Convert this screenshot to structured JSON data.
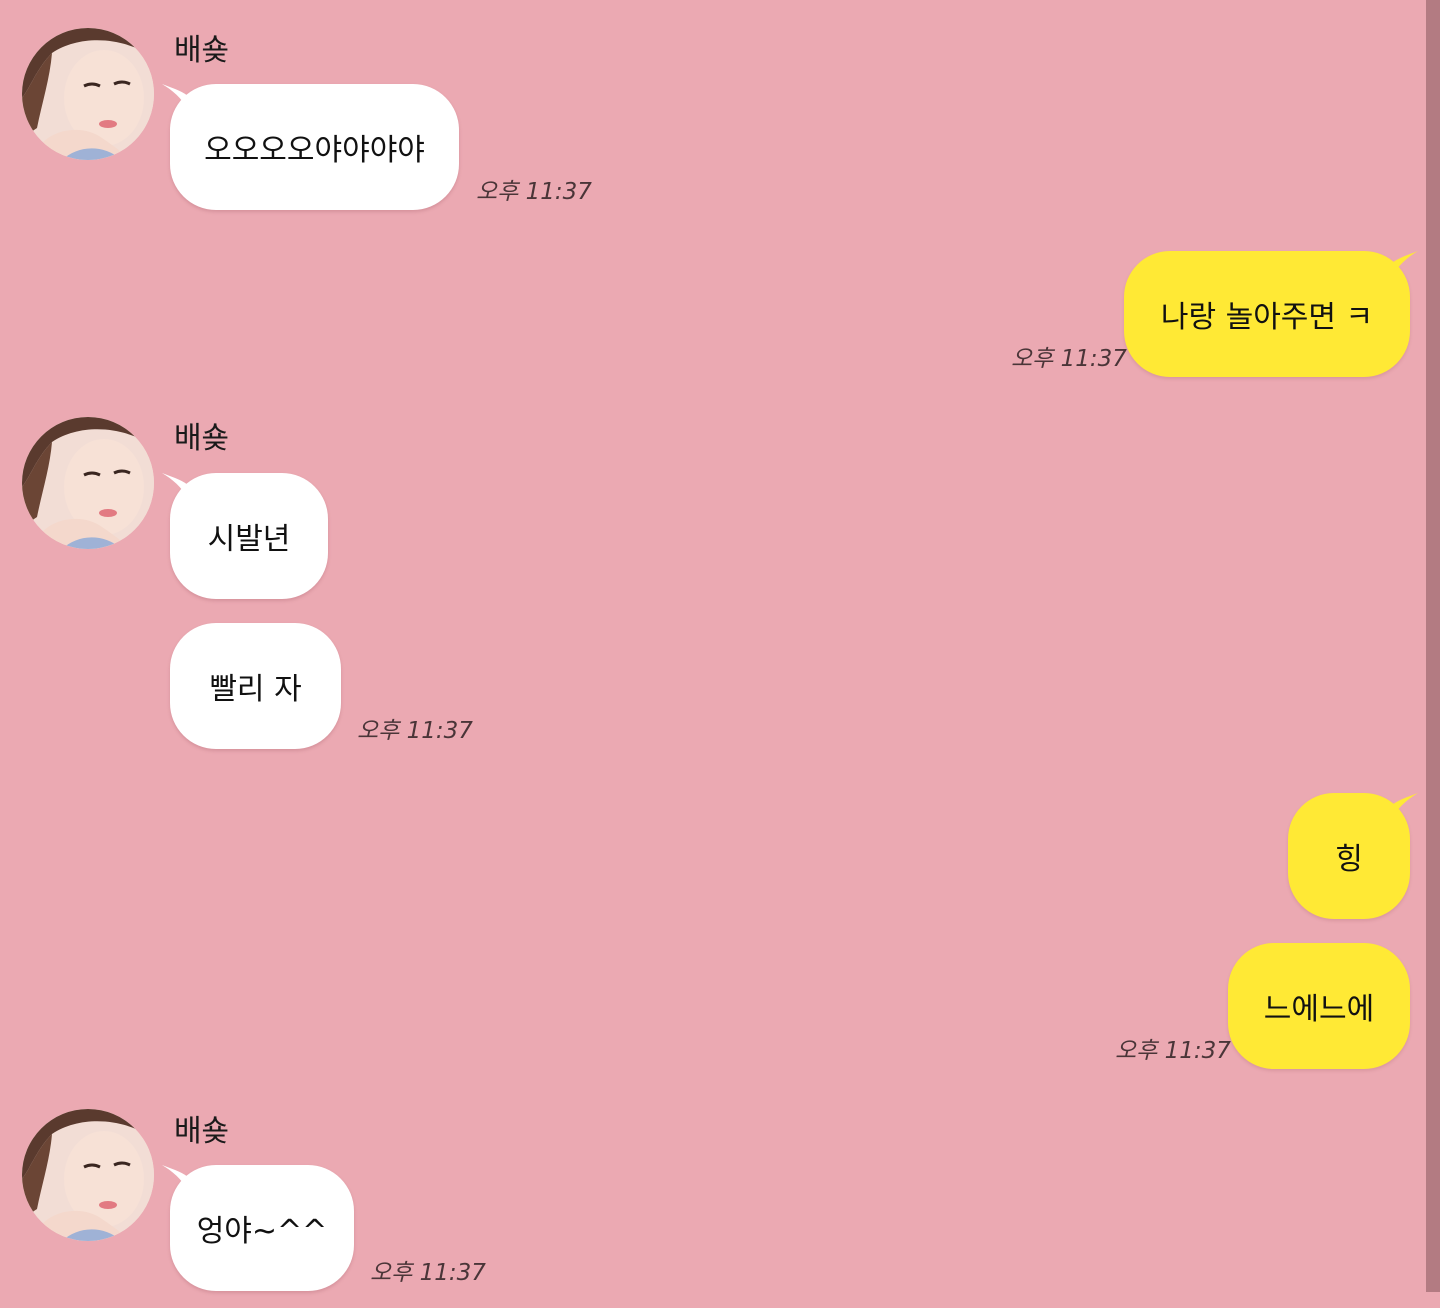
{
  "contact": {
    "name": "배숒"
  },
  "messages": [
    {
      "text": "오오오오야야야야",
      "time": "오후 11:37"
    },
    {
      "text": "나랑 놀아주면 ㅋ",
      "time": "오후 11:37"
    },
    {
      "text": "시발년"
    },
    {
      "text": "빨리 자",
      "time": "오후 11:37"
    },
    {
      "text": "힝"
    },
    {
      "text": "느에느에",
      "time": "오후 11:37"
    },
    {
      "text": "엉야~^^",
      "time": "오후 11:37"
    }
  ],
  "colors": {
    "background": "#eba9b2",
    "incoming_bubble": "#ffffff",
    "outgoing_bubble": "#ffe935",
    "scrollbar": "#b37b82"
  },
  "icons": {
    "avatar": "contact-profile-photo"
  }
}
